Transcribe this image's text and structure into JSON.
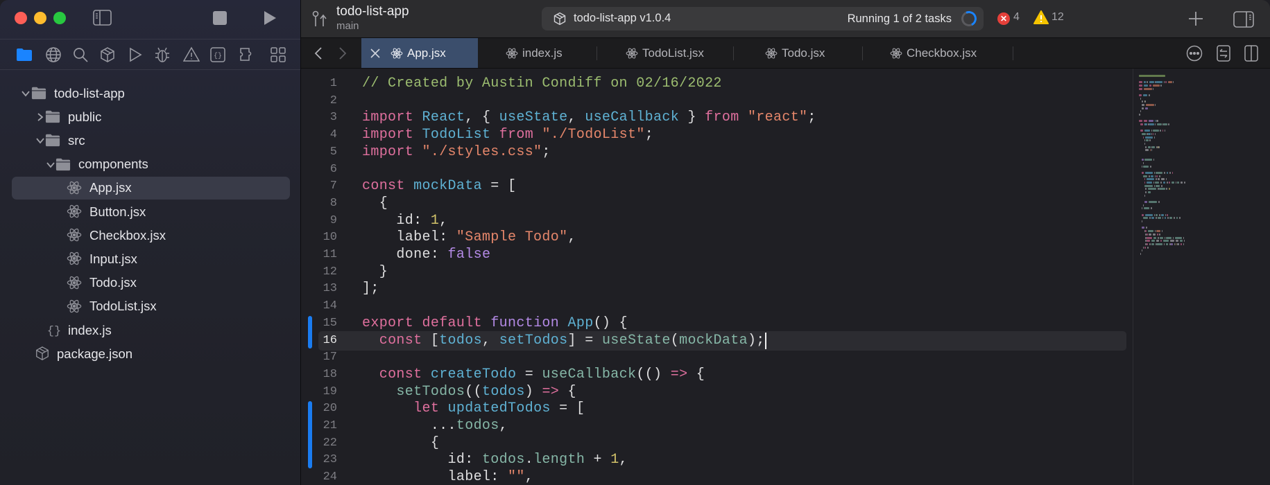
{
  "window": {
    "project_title": "todo-list-app",
    "branch": "main",
    "activity": {
      "scheme": "todo-list-app v1.0.4",
      "status": "Running 1 of 2 tasks",
      "errors": "4",
      "warnings": "12"
    }
  },
  "navigator_icons": [
    "folder-icon",
    "globe-icon",
    "search-icon",
    "cube-icon",
    "play-outline-icon",
    "bug-icon",
    "warning-icon",
    "braces-icon",
    "puzzle-icon",
    "grid-icon"
  ],
  "tree": [
    {
      "label": "todo-list-app",
      "type": "folder",
      "expanded": true,
      "depth": 0
    },
    {
      "label": "public",
      "type": "folder",
      "expanded": false,
      "depth": 1
    },
    {
      "label": "src",
      "type": "folder",
      "expanded": true,
      "depth": 1
    },
    {
      "label": "components",
      "type": "folder",
      "expanded": true,
      "depth": 2
    },
    {
      "label": "App.jsx",
      "type": "react",
      "depth": 3,
      "selected": true
    },
    {
      "label": "Button.jsx",
      "type": "react",
      "depth": 3
    },
    {
      "label": "Checkbox.jsx",
      "type": "react",
      "depth": 3
    },
    {
      "label": "Input.jsx",
      "type": "react",
      "depth": 3
    },
    {
      "label": "Todo.jsx",
      "type": "react",
      "depth": 3
    },
    {
      "label": "TodoList.jsx",
      "type": "react",
      "depth": 3
    },
    {
      "label": "index.js",
      "type": "js",
      "depth": 2
    },
    {
      "label": "package.json",
      "type": "package",
      "depth": 1
    }
  ],
  "tabs": [
    {
      "label": "App.jsx",
      "active": true
    },
    {
      "label": "index.js"
    },
    {
      "label": "TodoList.jsx"
    },
    {
      "label": "Todo.jsx"
    },
    {
      "label": "Checkbox.jsx"
    }
  ],
  "colors": {
    "accent": "#1a7cf0",
    "active_tab": "#3b4e6c",
    "error": "#e5403a",
    "warning": "#f5c400"
  },
  "editor": {
    "current_line": 16,
    "changed_lines": [
      15,
      16,
      20,
      21,
      22,
      23
    ],
    "lines": [
      [
        [
          "// Created by Austin Condiff on 02/16/2022",
          "comment"
        ]
      ],
      [],
      [
        [
          "import",
          "keyword"
        ],
        [
          " "
        ],
        [
          "React",
          "type"
        ],
        [
          ", { "
        ],
        [
          "useState",
          "type"
        ],
        [
          ", "
        ],
        [
          "useCallback",
          "type"
        ],
        [
          " } "
        ],
        [
          "from",
          "keyword"
        ],
        [
          " "
        ],
        [
          "\"react\"",
          "string"
        ],
        [
          ";"
        ]
      ],
      [
        [
          "import",
          "keyword"
        ],
        [
          " "
        ],
        [
          "TodoList",
          "type"
        ],
        [
          " "
        ],
        [
          "from",
          "keyword"
        ],
        [
          " "
        ],
        [
          "\"./TodoList\"",
          "string"
        ],
        [
          ";"
        ]
      ],
      [
        [
          "import",
          "keyword"
        ],
        [
          " "
        ],
        [
          "\"./styles.css\"",
          "string"
        ],
        [
          ";"
        ]
      ],
      [],
      [
        [
          "const",
          "keyword"
        ],
        [
          " "
        ],
        [
          "mockData",
          "type"
        ],
        [
          " = ["
        ]
      ],
      [
        [
          "  {"
        ]
      ],
      [
        [
          "    id: "
        ],
        [
          "1",
          "number"
        ],
        [
          ","
        ]
      ],
      [
        [
          "    label: "
        ],
        [
          "\"Sample Todo\"",
          "string"
        ],
        [
          ","
        ]
      ],
      [
        [
          "    done: "
        ],
        [
          "false",
          "purple"
        ]
      ],
      [
        [
          "  }"
        ]
      ],
      [
        [
          "];"
        ]
      ],
      [],
      [
        [
          "export",
          "keyword"
        ],
        [
          " "
        ],
        [
          "default",
          "keyword"
        ],
        [
          " "
        ],
        [
          "function",
          "purple"
        ],
        [
          " "
        ],
        [
          "App",
          "type"
        ],
        [
          "() {"
        ]
      ],
      [
        [
          "  "
        ],
        [
          "const",
          "keyword"
        ],
        [
          " ["
        ],
        [
          "todos",
          "var"
        ],
        [
          ", "
        ],
        [
          "setTodos",
          "var"
        ],
        [
          "] = "
        ],
        [
          "useState",
          "call"
        ],
        [
          "("
        ],
        [
          "mockData",
          "call"
        ],
        [
          ");"
        ]
      ],
      [],
      [
        [
          "  "
        ],
        [
          "const",
          "keyword"
        ],
        [
          " "
        ],
        [
          "createTodo",
          "type"
        ],
        [
          " = "
        ],
        [
          "useCallback",
          "call"
        ],
        [
          "(() "
        ],
        [
          "=>",
          "keyword"
        ],
        [
          " {"
        ]
      ],
      [
        [
          "    "
        ],
        [
          "setTodos",
          "call"
        ],
        [
          "(("
        ],
        [
          "todos",
          "var"
        ],
        [
          ") "
        ],
        [
          "=>",
          "keyword"
        ],
        [
          " {"
        ]
      ],
      [
        [
          "      "
        ],
        [
          "let",
          "keyword"
        ],
        [
          " "
        ],
        [
          "updatedTodos",
          "type"
        ],
        [
          " = ["
        ]
      ],
      [
        [
          "        ..."
        ],
        [
          "todos",
          "call"
        ],
        [
          ","
        ]
      ],
      [
        [
          "        {"
        ]
      ],
      [
        [
          "          id: "
        ],
        [
          "todos",
          "call"
        ],
        [
          "."
        ],
        [
          "length",
          "call"
        ],
        [
          " + "
        ],
        [
          "1",
          "number"
        ],
        [
          ","
        ]
      ],
      [
        [
          "          label: "
        ],
        [
          "\"\"",
          "string"
        ],
        [
          ","
        ]
      ]
    ]
  }
}
